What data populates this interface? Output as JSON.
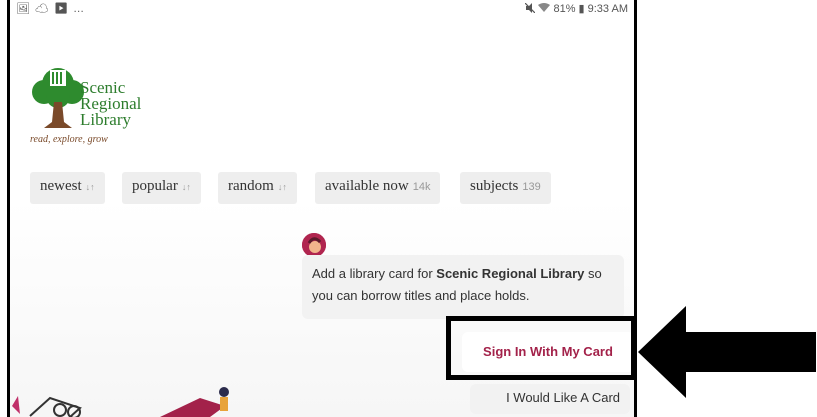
{
  "status_bar": {
    "left_icons": "🖼 ☁ ▶ …",
    "right_text": "81% ▮ 9:33 AM"
  },
  "library": {
    "logo_line1": "Scenic",
    "logo_line2": "Regional",
    "logo_line3": "Library",
    "tagline": "read, explore, grow"
  },
  "tabs": [
    {
      "label": "newest",
      "arrow": "↓↑"
    },
    {
      "label": "popular",
      "arrow": "↓↑"
    },
    {
      "label": "random",
      "arrow": "↓↑"
    },
    {
      "label": "available now",
      "count": "14k"
    },
    {
      "label": "subjects",
      "count": "139"
    }
  ],
  "prompt": {
    "text_before": "Add a library card for ",
    "library_name": "Scenic Regional Library",
    "text_after": " so you can borrow titles and place holds."
  },
  "buttons": {
    "sign_in": "Sign In With My Card",
    "would_like": "I Would Like A Card"
  },
  "colors": {
    "accent": "#a3224a",
    "logo_green": "#2d7d2d",
    "annotation": "#000000"
  }
}
